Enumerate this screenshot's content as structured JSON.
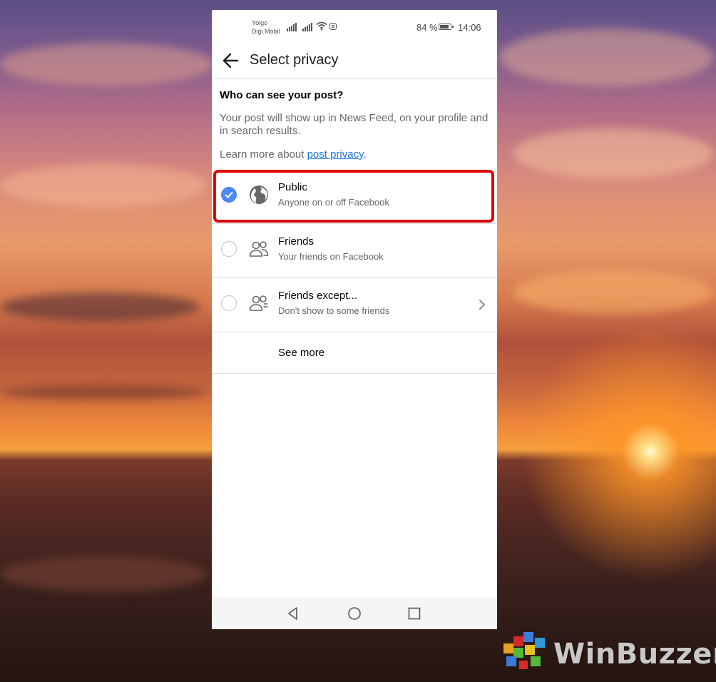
{
  "status_bar": {
    "carrier_1": "Yoigo",
    "carrier_2": "Digi.Mobil",
    "battery_pct": "84 %",
    "time": "14:06"
  },
  "header": {
    "title": "Select privacy"
  },
  "intro": {
    "heading": "Who can see your post?",
    "description": "Your post will show up in News Feed, on your profile and in search results.",
    "learn_prefix": "Learn more about ",
    "learn_link": "post privacy",
    "learn_suffix": "."
  },
  "options": [
    {
      "label": "Public",
      "subtitle": "Anyone on or off Facebook",
      "icon": "globe-icon",
      "selected": true
    },
    {
      "label": "Friends",
      "subtitle": "Your friends on Facebook",
      "icon": "friends-icon",
      "selected": false
    },
    {
      "label": "Friends except...",
      "subtitle": "Don't show to some friends",
      "icon": "friends-except-icon",
      "selected": false
    }
  ],
  "see_more": "See more",
  "watermark": {
    "text": "WinBuzzer"
  },
  "colors": {
    "accent_blue": "#4a89f3",
    "link_blue": "#1b74e4",
    "highlight_red": "#e00000"
  }
}
